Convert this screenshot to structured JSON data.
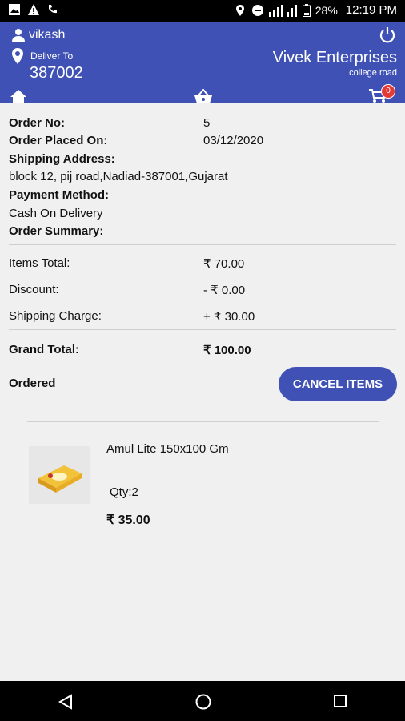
{
  "status_bar": {
    "battery": "28%",
    "time": "12:19 PM"
  },
  "header": {
    "user_name": "vikash",
    "deliver_to_label": "Deliver To",
    "pincode": "387002",
    "store_name": "Vivek Enterprises",
    "store_location": "college road",
    "cart_count": "0"
  },
  "order": {
    "order_no_label": "Order No:",
    "order_no": "5",
    "placed_on_label": "Order Placed On:",
    "placed_on": "03/12/2020",
    "shipping_address_label": "Shipping Address:",
    "shipping_address": "block 12, pij road,Nadiad-387001,Gujarat",
    "payment_method_label": "Payment Method:",
    "payment_method": "Cash On Delivery",
    "summary_label": "Order Summary:",
    "items_total_label": "Items Total:",
    "items_total": "₹ 70.00",
    "discount_label": "Discount:",
    "discount": "- ₹ 0.00",
    "shipping_charge_label": "Shipping Charge:",
    "shipping_charge": "+ ₹ 30.00",
    "grand_total_label": "Grand Total:",
    "grand_total": "₹ 100.00",
    "status": "Ordered",
    "cancel_label": "CANCEL ITEMS"
  },
  "item": {
    "name": "Amul Lite 150x100 Gm",
    "qty": "Qty:2",
    "price": "₹ 35.00"
  },
  "colors": {
    "primary": "#3f51b5",
    "badge": "#e53935"
  }
}
